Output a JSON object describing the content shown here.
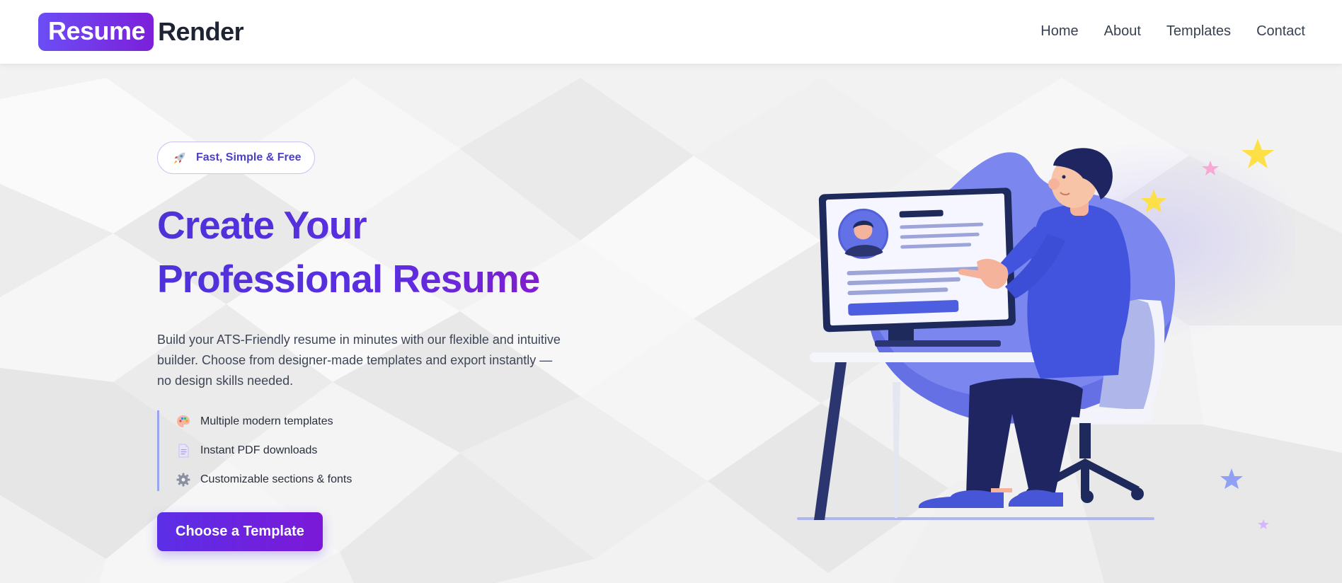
{
  "brand": {
    "logo_highlight": "Resume",
    "logo_rest": "Render"
  },
  "nav": {
    "links": [
      {
        "label": "Home"
      },
      {
        "label": "About"
      },
      {
        "label": "Templates"
      },
      {
        "label": "Contact"
      }
    ]
  },
  "hero": {
    "badge_label": "Fast, Simple & Free",
    "headline_line1": "Create Your",
    "headline_line2": "Professional Resume",
    "description": "Build your ATS-Friendly resume in minutes with our flexible and intuitive builder. Choose from designer-made templates and export instantly — no design skills needed.",
    "features": [
      {
        "icon": "palette-icon",
        "label": "Multiple modern templates"
      },
      {
        "icon": "document-icon",
        "label": "Instant PDF downloads"
      },
      {
        "icon": "gear-icon",
        "label": "Customizable sections & fonts"
      }
    ],
    "cta_label": "Choose a Template"
  },
  "colors": {
    "brand_primary": "#5b2fe6",
    "brand_secondary": "#7c18d8",
    "headline": "#4e32d8",
    "illustration_blob": "#7b86ef"
  }
}
